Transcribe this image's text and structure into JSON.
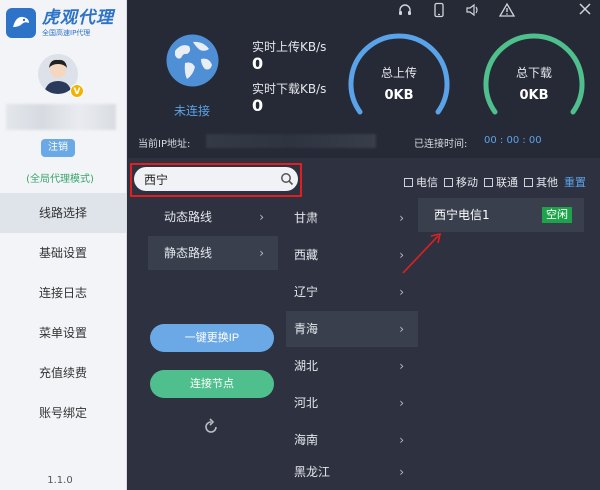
{
  "app": {
    "logo_title": "虎观代理",
    "logo_subtitle": "全国高速IP代理",
    "avatar_badge": "V"
  },
  "sidebar": {
    "logout_label": "注销",
    "mode_label": "(全局代理模式)",
    "items": [
      {
        "label": "线路选择",
        "active": true
      },
      {
        "label": "基础设置",
        "active": false
      },
      {
        "label": "连接日志",
        "active": false
      },
      {
        "label": "菜单设置",
        "active": false
      },
      {
        "label": "充值续费",
        "active": false
      },
      {
        "label": "账号绑定",
        "active": false
      }
    ],
    "version": "1.1.0"
  },
  "header": {
    "icons": [
      "headset-icon",
      "phone-icon",
      "speaker-icon",
      "warning-icon",
      "close-icon"
    ],
    "connection_status": "未连接",
    "upload_rate_label": "实时上传KB/s",
    "upload_rate_value": "0",
    "download_rate_label": "实时下载KB/s",
    "download_rate_value": "0",
    "total_upload_label": "总上传",
    "total_upload_value": "0KB",
    "total_download_label": "总下载",
    "total_download_value": "0KB",
    "current_ip_label": "当前IP地址:",
    "connected_time_label": "已连接时间:",
    "connected_time_value": "00 : 00 : 00"
  },
  "search": {
    "value": "西宁",
    "placeholder": ""
  },
  "filters": {
    "options": [
      "电信",
      "移动",
      "联通",
      "其他"
    ],
    "reset_label": "重置"
  },
  "routes": [
    {
      "label": "动态路线",
      "active": false
    },
    {
      "label": "静态路线",
      "active": true
    }
  ],
  "provinces": [
    {
      "label": "甘肃",
      "active": false
    },
    {
      "label": "西藏",
      "active": false
    },
    {
      "label": "辽宁",
      "active": false
    },
    {
      "label": "青海",
      "active": true
    },
    {
      "label": "湖北",
      "active": false
    },
    {
      "label": "河北",
      "active": false
    },
    {
      "label": "海南",
      "active": false
    },
    {
      "label": "黑龙江",
      "active": false
    }
  ],
  "nodes": [
    {
      "name": "西宁电信1",
      "status": "空闲"
    }
  ],
  "actions": {
    "switch_ip_label": "一键更换IP",
    "connect_label": "连接节点"
  },
  "colors": {
    "accent_blue": "#5aa3e8",
    "accent_green": "#4fc08d",
    "idle_badge": "#1ea34a",
    "highlight_red": "#e02020"
  }
}
